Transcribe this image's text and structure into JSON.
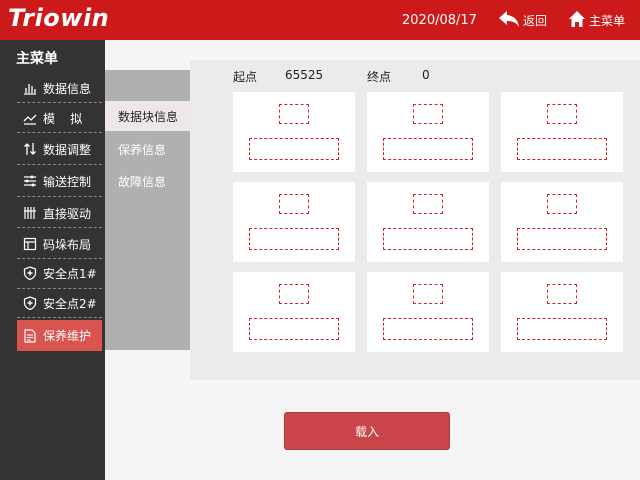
{
  "header": {
    "logo": "Triowin",
    "date": "2020/08/17",
    "back_label": "返回",
    "home_label": "主菜单",
    "color": "#cc1a1a"
  },
  "sidebar": {
    "title": "主菜单",
    "items": [
      {
        "label": "数据信息",
        "icon": "bar-chart-icon"
      },
      {
        "label": "模    拟",
        "icon": "line-chart-icon"
      },
      {
        "label": "数据调整",
        "icon": "up-down-arrows-icon"
      },
      {
        "label": "输送控制",
        "icon": "sliders-icon"
      },
      {
        "label": "直接驱动",
        "icon": "fork-icon"
      },
      {
        "label": "码垛布局",
        "icon": "layout-icon"
      },
      {
        "label": "安全点1#",
        "icon": "shield-plus-icon"
      },
      {
        "label": "安全点2#",
        "icon": "shield-plus-icon"
      },
      {
        "label": "保养维护",
        "icon": "maintenance-doc-icon",
        "active": true
      }
    ],
    "active_color": "#d9534f"
  },
  "submenu": {
    "items": [
      {
        "label": "数据块信息",
        "active": true
      },
      {
        "label": "保养信息"
      },
      {
        "label": "故障信息"
      }
    ]
  },
  "main": {
    "start_label": "起点",
    "start_value": "65525",
    "end_label": "终点",
    "end_value": "0",
    "load_button": "载入",
    "card_count": 9
  }
}
